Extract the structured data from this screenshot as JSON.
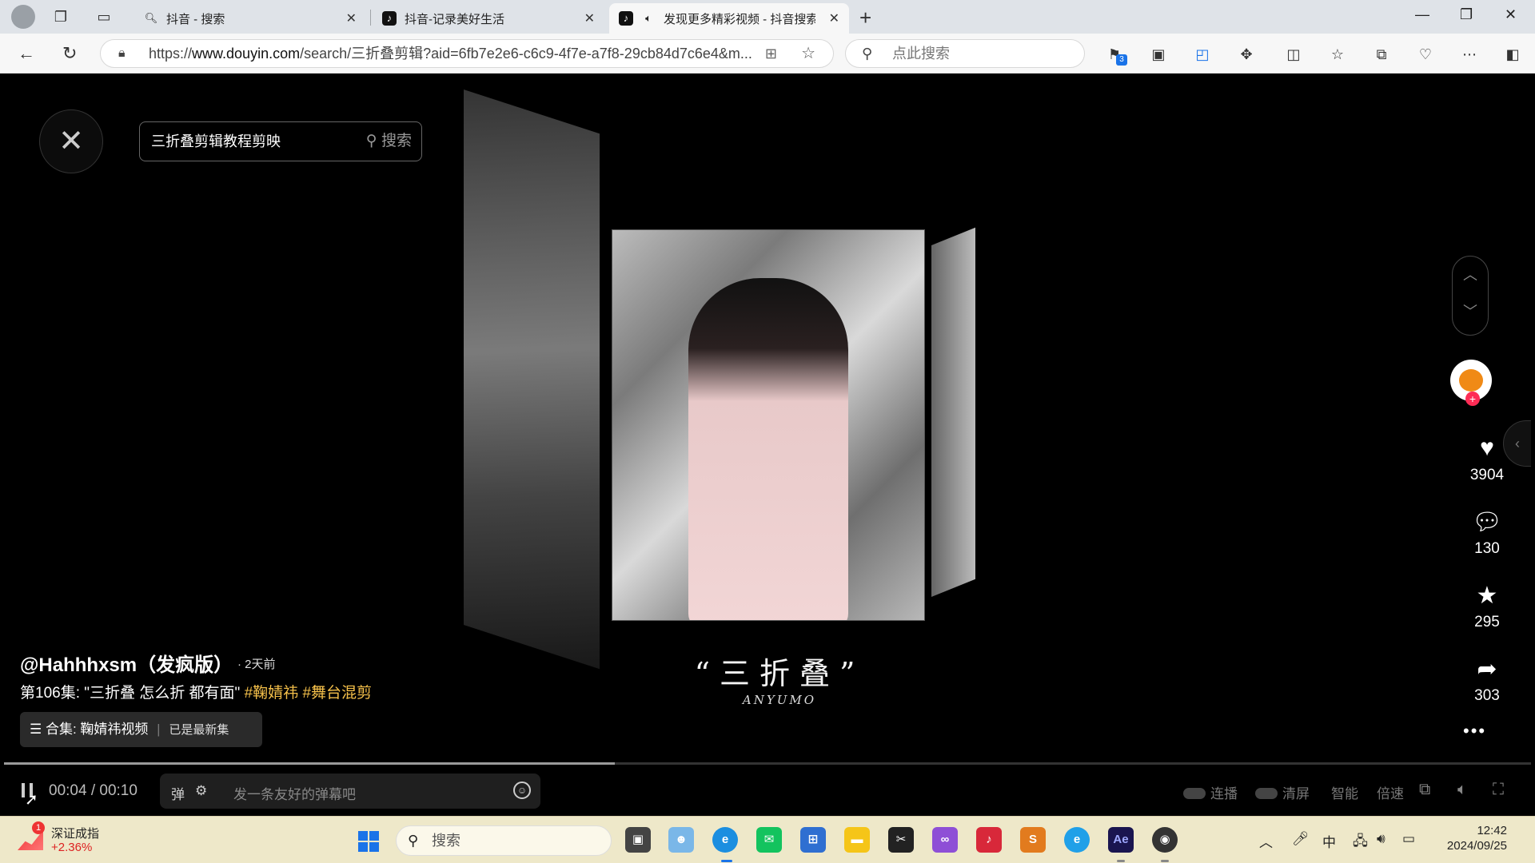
{
  "browser": {
    "tabs": [
      {
        "label": "抖音 - 搜索",
        "icon": "search-icon",
        "active": false
      },
      {
        "label": "抖音-记录美好生活",
        "icon": "douyin-icon",
        "active": false
      },
      {
        "label": "发现更多精彩视频 - 抖音搜索",
        "icon": "douyin-icon",
        "active": true
      }
    ],
    "url_prefix": "https://",
    "url_host": "www.douyin.com",
    "url_rest": "/search/三折叠剪辑?aid=6fb7e2e6-c6c9-4f7e-a7f8-29cb84d7c6e4&m...",
    "search_placeholder": "点此搜索",
    "extension_badge": "3"
  },
  "video": {
    "search_value": "三折叠剪辑教程剪映",
    "search_button": "搜索",
    "overlay_title": "“三折叠”",
    "overlay_sub": "ANYUMO",
    "author": "@Hahhhxsm（发疯版）",
    "posted": "· 2天前",
    "description": "第106集: \"三折叠 怎么折 都有面\"",
    "tags": [
      "#鞠婧祎",
      "#舞台混剪"
    ],
    "collection_label": "合集: 鞠婧祎视频",
    "collection_status": "已是最新集",
    "likes": "3904",
    "comments": "130",
    "favorites": "295",
    "shares": "303",
    "progress": 0.4,
    "time_current": "00:04",
    "time_total": "00:10",
    "danmaku_placeholder": "发一条友好的弹幕吧",
    "controls": {
      "autoplay": "连播",
      "clear": "清屏",
      "quality": "智能",
      "speed": "倍速"
    }
  },
  "taskbar": {
    "stock_name": "深证成指",
    "stock_change": "+2.36%",
    "stock_badge": "1",
    "search_placeholder": "搜索",
    "ime": "中",
    "time": "12:42",
    "date": "2024/09/25"
  },
  "colors": {
    "tag": "#f5c04a",
    "like_red": "#fe2c55",
    "taskbar": "#eee8c9"
  }
}
